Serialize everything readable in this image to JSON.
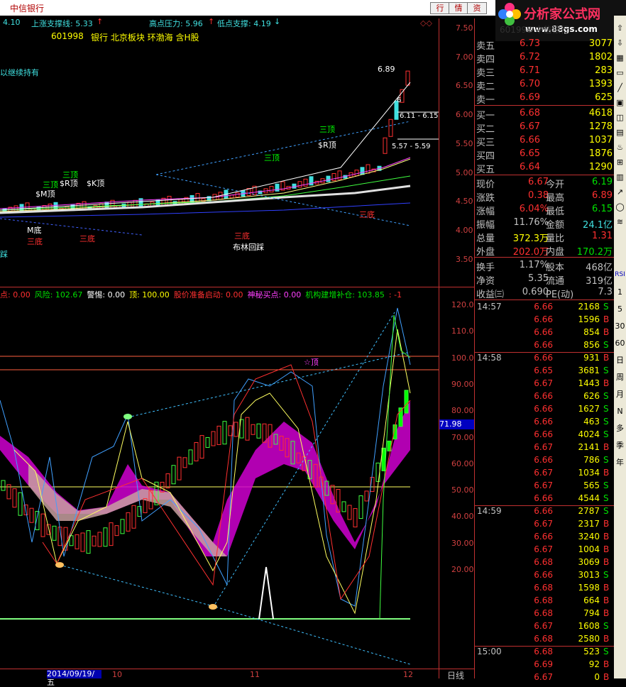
{
  "window": {
    "title": "中信银行",
    "buttons": [
      "行",
      "情",
      "资"
    ]
  },
  "logo": {
    "text": "分析家公式网",
    "url": "www.88gs.com"
  },
  "stock_info": {
    "support_prefix": "4.10",
    "up_support_label": "上涨支撑线: 5.33",
    "high_pressure_label": "高点压力: 5.96",
    "low_support_label": "低点支撑: 4.19",
    "code": "601998",
    "tags": "银行 北京板块 环渤海 含H股",
    "overlay": "601998 中信银行",
    "hold_hint": "以继续持有"
  },
  "main_chart": {
    "price_axis": [
      "7.50",
      "7.00",
      "6.50",
      "6.00",
      "5.50",
      "5.00",
      "4.50",
      "4.00",
      "3.50"
    ],
    "price_labels": [
      "6.89",
      "6.11 - 6.15",
      "5.57 - 5.59",
      "6"
    ],
    "signals": [
      "三顶",
      "$R顶",
      "三顶",
      "$K顶",
      "$R顶",
      "三顶",
      "$M顶",
      "三顶",
      "M底",
      "三底",
      "三底",
      "三底",
      "布林回踩",
      "三底",
      "踩"
    ]
  },
  "indicator": {
    "legend": [
      {
        "text": "点: 0.00",
        "color": "#ff3030"
      },
      {
        "text": "风险: 102.67",
        "color": "#00e000"
      },
      {
        "text": "警惕: 0.00",
        "color": "#ffffff"
      },
      {
        "text": "顶: 100.00",
        "color": "#ffff00"
      },
      {
        "text": "股价准备启动: 0.00",
        "color": "#ff3030"
      },
      {
        "text": "神秘买点: 0.00",
        "color": "#ff40ff"
      },
      {
        "text": "机构建增补仓: 103.85",
        "color": "#00e000"
      },
      {
        "text": ": -1",
        "color": "#ff3030"
      }
    ],
    "axis": [
      "120.0",
      "110.0",
      "100.0",
      "90.00",
      "80.00",
      "70.00",
      "60.00",
      "50.00",
      "40.00",
      "30.00",
      "20.00"
    ],
    "current_value": "71.98",
    "top_label": "☆顶"
  },
  "date_axis": {
    "date": "2014/09/19/五",
    "months": [
      "10",
      "11",
      "12"
    ],
    "period": "日线"
  },
  "order_book": {
    "asks": [
      {
        "label": "卖五",
        "price": "6.73",
        "vol": "3077"
      },
      {
        "label": "卖四",
        "price": "6.72",
        "vol": "1802"
      },
      {
        "label": "卖三",
        "price": "6.71",
        "vol": "283"
      },
      {
        "label": "卖二",
        "price": "6.70",
        "vol": "1393"
      },
      {
        "label": "卖一",
        "price": "6.69",
        "vol": "625"
      }
    ],
    "bids": [
      {
        "label": "买一",
        "price": "6.68",
        "vol": "4618"
      },
      {
        "label": "买二",
        "price": "6.67",
        "vol": "1278"
      },
      {
        "label": "买三",
        "price": "6.66",
        "vol": "1037"
      },
      {
        "label": "买四",
        "price": "6.65",
        "vol": "1876"
      },
      {
        "label": "买五",
        "price": "6.64",
        "vol": "1290"
      }
    ]
  },
  "stats": [
    {
      "l1": "现价",
      "v1": "6.67",
      "c1": "#ff3030",
      "l2": "今开",
      "v2": "6.19",
      "c2": "#00e000"
    },
    {
      "l1": "涨跌",
      "v1": "0.38",
      "c1": "#ff3030",
      "l2": "最高",
      "v2": "6.89",
      "c2": "#ff3030"
    },
    {
      "l1": "涨幅",
      "v1": "6.04%",
      "c1": "#ff3030",
      "l2": "最低",
      "v2": "6.15",
      "c2": "#00e000"
    },
    {
      "l1": "振幅",
      "v1": "11.76%",
      "c1": "#c0c0c0",
      "l2": "金额",
      "v2": "24.1亿",
      "c2": "#40e0e0"
    },
    {
      "l1": "总量",
      "v1": "372.3万",
      "c1": "#ffff00",
      "l2": "量比",
      "v2": "1.31",
      "c2": "#ff3030"
    },
    {
      "l1": "外盘",
      "v1": "202.0万",
      "c1": "#ff3030",
      "l2": "内盘",
      "v2": "170.2万",
      "c2": "#00e000"
    },
    {
      "l1": "换手",
      "v1": "1.17%",
      "c1": "#c0c0c0",
      "l2": "股本",
      "v2": "468亿",
      "c2": "#c0c0c0"
    },
    {
      "l1": "净资",
      "v1": "5.35",
      "c1": "#c0c0c0",
      "l2": "流通",
      "v2": "319亿",
      "c2": "#c0c0c0"
    },
    {
      "l1": "收益㈢",
      "v1": "0.690",
      "c1": "#c0c0c0",
      "l2": "PE(动)",
      "v2": "7.3",
      "c2": "#c0c0c0"
    }
  ],
  "ticks": [
    {
      "time": "14:57",
      "price": "6.66",
      "vol": "2168",
      "bs": "S"
    },
    {
      "time": "",
      "price": "6.66",
      "vol": "1596",
      "bs": "B"
    },
    {
      "time": "",
      "price": "6.66",
      "vol": "854",
      "bs": "B"
    },
    {
      "time": "",
      "price": "6.66",
      "vol": "856",
      "bs": "S"
    },
    {
      "time": "14:58",
      "price": "6.66",
      "vol": "931",
      "bs": "B"
    },
    {
      "time": "",
      "price": "6.65",
      "vol": "3681",
      "bs": "S"
    },
    {
      "time": "",
      "price": "6.67",
      "vol": "1443",
      "bs": "B"
    },
    {
      "time": "",
      "price": "6.66",
      "vol": "626",
      "bs": "S"
    },
    {
      "time": "",
      "price": "6.66",
      "vol": "1627",
      "bs": "S"
    },
    {
      "time": "",
      "price": "6.66",
      "vol": "463",
      "bs": "S"
    },
    {
      "time": "",
      "price": "6.66",
      "vol": "4024",
      "bs": "S"
    },
    {
      "time": "",
      "price": "6.67",
      "vol": "2141",
      "bs": "B"
    },
    {
      "time": "",
      "price": "6.66",
      "vol": "786",
      "bs": "S"
    },
    {
      "time": "",
      "price": "6.67",
      "vol": "1034",
      "bs": "B"
    },
    {
      "time": "",
      "price": "6.67",
      "vol": "565",
      "bs": "S"
    },
    {
      "time": "",
      "price": "6.66",
      "vol": "4544",
      "bs": "S"
    },
    {
      "time": "14:59",
      "price": "6.66",
      "vol": "2787",
      "bs": "S"
    },
    {
      "time": "",
      "price": "6.67",
      "vol": "2317",
      "bs": "B"
    },
    {
      "time": "",
      "price": "6.66",
      "vol": "3240",
      "bs": "B"
    },
    {
      "time": "",
      "price": "6.67",
      "vol": "1004",
      "bs": "B"
    },
    {
      "time": "",
      "price": "6.68",
      "vol": "3069",
      "bs": "B"
    },
    {
      "time": "",
      "price": "6.66",
      "vol": "3013",
      "bs": "S"
    },
    {
      "time": "",
      "price": "6.68",
      "vol": "1598",
      "bs": "B"
    },
    {
      "time": "",
      "price": "6.68",
      "vol": "664",
      "bs": "B"
    },
    {
      "time": "",
      "price": "6.68",
      "vol": "794",
      "bs": "B"
    },
    {
      "time": "",
      "price": "6.67",
      "vol": "1608",
      "bs": "S"
    },
    {
      "time": "",
      "price": "6.68",
      "vol": "2580",
      "bs": "B"
    },
    {
      "time": "15:00",
      "price": "6.68",
      "vol": "523",
      "bs": "S"
    },
    {
      "time": "",
      "price": "6.69",
      "vol": "92",
      "bs": "B"
    },
    {
      "time": "",
      "price": "6.67",
      "vol": "0",
      "bs": "B"
    }
  ],
  "toolbar": [
    "RSI",
    "1",
    "5",
    "30",
    "60",
    "日",
    "周",
    "月",
    "N",
    "多",
    "季",
    "年"
  ]
}
